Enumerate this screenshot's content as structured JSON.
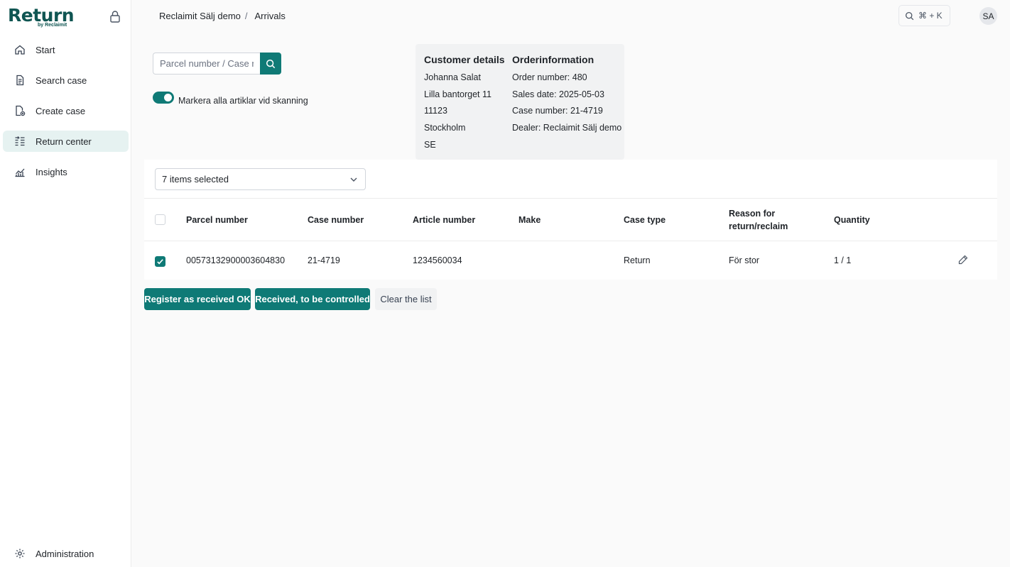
{
  "sidebar": {
    "logo": {
      "main": "Return",
      "sub": "by Reclaimit"
    },
    "items": [
      {
        "label": "Start",
        "icon": "home-icon"
      },
      {
        "label": "Search case",
        "icon": "document-icon"
      },
      {
        "label": "Create case",
        "icon": "file-add-icon"
      },
      {
        "label": "Return center",
        "icon": "return-list-icon",
        "active": true
      },
      {
        "label": "Insights",
        "icon": "chart-icon"
      }
    ],
    "footer": {
      "label": "Administration",
      "icon": "gear-icon"
    }
  },
  "header": {
    "breadcrumb": {
      "parent": "Reclaimit Sälj demo",
      "separator": "/",
      "current": "Arrivals"
    },
    "command": {
      "shortcut": "⌘ + K"
    },
    "user": {
      "initials": "SA"
    }
  },
  "search": {
    "placeholder": "Parcel number / Case number"
  },
  "toggle": {
    "label": "Markera alla artiklar vid skanning",
    "checked": true
  },
  "customer": {
    "title": "Customer details",
    "lines": [
      "Johanna Salat",
      "Lilla bantorget 11",
      "11123",
      "Stockholm",
      "SE"
    ]
  },
  "order": {
    "title": "Orderinformation",
    "lines": [
      "Order number: 480",
      "Sales date: 2025-05-03",
      "Case number: 21-4719",
      "Dealer: Reclaimit Sälj demo"
    ]
  },
  "filter": {
    "value": "7 items selected"
  },
  "table": {
    "headers": {
      "parcel": "Parcel number",
      "case": "Case number",
      "article": "Article number",
      "make": "Make",
      "type": "Case type",
      "reason_1": "Reason for",
      "reason_2": "return/reclaim",
      "quantity": "Quantity"
    },
    "rows": [
      {
        "checked": true,
        "parcel": "00573132900003604830",
        "case": "21-4719",
        "article": "1234560034",
        "make": "",
        "type": "Return",
        "reason": "För stor",
        "quantity": "1 / 1"
      }
    ]
  },
  "actions": {
    "register_ok": "Register as received OK",
    "to_control": "Received, to be controlled",
    "clear": "Clear the list"
  },
  "colors": {
    "accent": "#0f7a76",
    "brand": "#0f5552",
    "active_nav": "#e6f2f1"
  }
}
